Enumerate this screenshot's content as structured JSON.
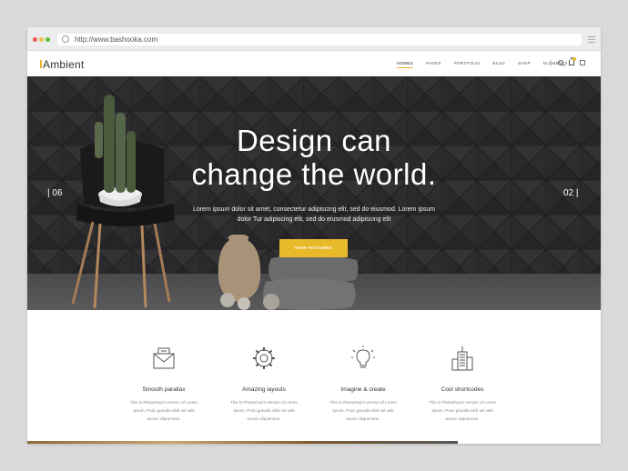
{
  "browser": {
    "url": "http://www.bashooka.com"
  },
  "header": {
    "logo": "Ambient",
    "nav": [
      "HOMES",
      "PAGES",
      "PORTFOLIO",
      "BLOG",
      "SHOP",
      "ELEMENTS"
    ],
    "active_nav": "HOMES"
  },
  "hero": {
    "title_line1": "Design can",
    "title_line2": "change the world.",
    "text_line1": "Lorem ipsum dolor sit amet, consectetur adipiscing elit, sed do eiusmod. Lorem ipsum",
    "text_line2": "dolor Tur adipiscing elit, sed do eiusmod adipiscing elit",
    "button": "VIEW FEATURES",
    "slide_prev": "| 06",
    "slide_next": "02 |"
  },
  "features": [
    {
      "icon": "mail-icon",
      "title": "Smooth parallax",
      "desc_line1": "This is Photoshop's version of Lorem",
      "desc_line2": "Ipsum. Proin gravida nibh vel velit",
      "desc_line3": "auctor aliquenean."
    },
    {
      "icon": "gear-icon",
      "title": "Amazing layouts",
      "desc_line1": "This is Photoshop's version of Lorem",
      "desc_line2": "Ipsum. Proin gravida nibh vel velit",
      "desc_line3": "auctor aliquenean."
    },
    {
      "icon": "lightbulb-icon",
      "title": "Imagine & create",
      "desc_line1": "This is Photoshop's version of Lorem",
      "desc_line2": "Ipsum. Proin gravida nibh vel velit",
      "desc_line3": "auctor aliquenean."
    },
    {
      "icon": "building-icon",
      "title": "Cool shortcodes",
      "desc_line1": "This is Photoshop's version of Lorem",
      "desc_line2": "Ipsum. Proin gravida nibh vel velit",
      "desc_line3": "auctor aliquenean."
    }
  ],
  "colors": {
    "accent": "#e8b928",
    "hero_bg": "#2b2b2d"
  }
}
